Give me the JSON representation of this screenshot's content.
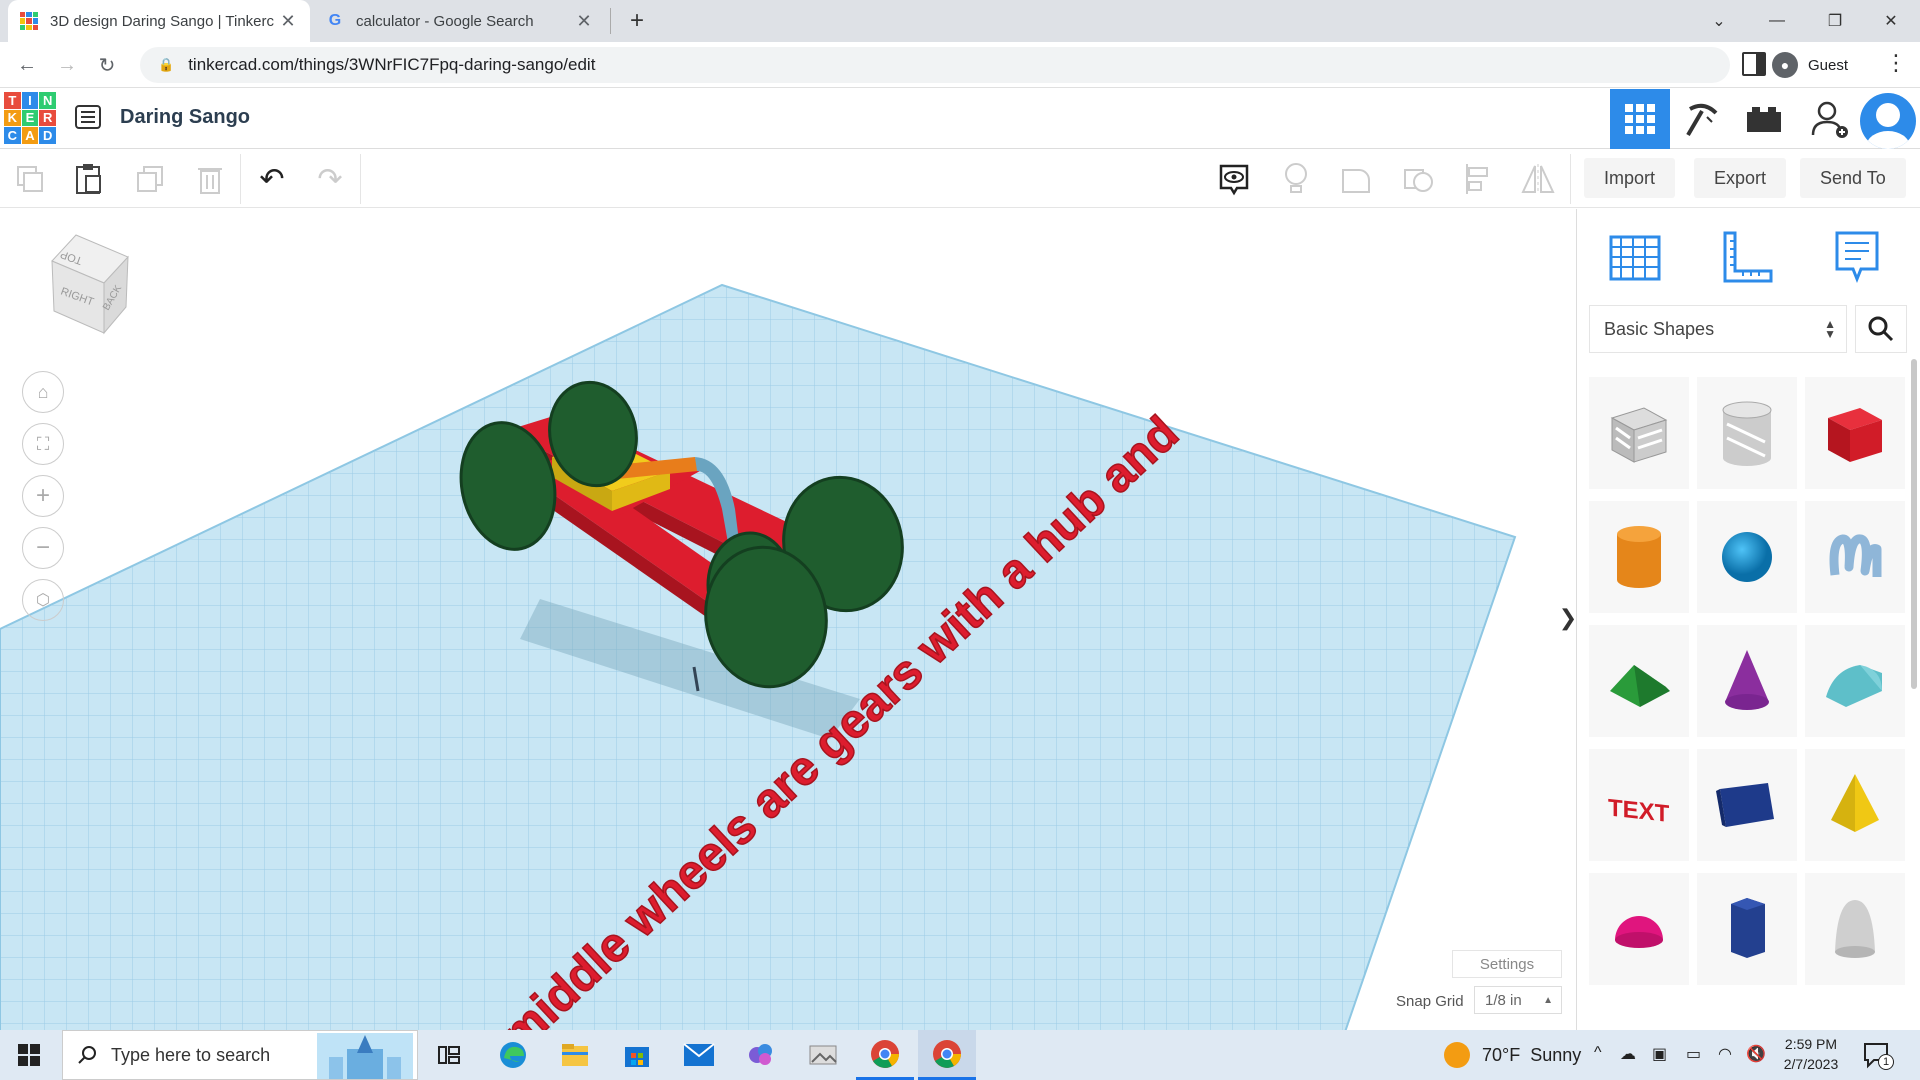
{
  "browser": {
    "tabs": [
      {
        "title": "3D design Daring Sango | Tinkerc",
        "active": true
      },
      {
        "title": "calculator - Google Search",
        "active": false
      }
    ],
    "url": "tinkercad.com/things/3WNrFIC7Fpq-daring-sango/edit",
    "profile_label": "Guest"
  },
  "app": {
    "logo_letters": [
      "T",
      "I",
      "N",
      "K",
      "E",
      "R",
      "C",
      "A",
      "D"
    ],
    "design_name": "Daring Sango",
    "actions": {
      "import": "Import",
      "export": "Export",
      "send_to": "Send To"
    }
  },
  "viewcube": {
    "top": "TOP",
    "right": "RIGHT",
    "back": "BACK"
  },
  "scene": {
    "text_label": "middle wheels are gears with a hub and"
  },
  "panel": {
    "library": "Basic Shapes",
    "shapes": [
      "Box Hole",
      "Cylinder Hole",
      "Box",
      "Cylinder",
      "Sphere",
      "Scribble",
      "Roof",
      "Cone",
      "Round Roof",
      "Text",
      "Shape Generators",
      "Pyramid",
      "Half Sphere",
      "Polygon",
      "Paraboloid"
    ],
    "toggle_glyph": "❯"
  },
  "grid": {
    "settings_label": "Settings",
    "snap_label": "Snap Grid",
    "snap_value": "1/8 in"
  },
  "taskbar": {
    "search_placeholder": "Type here to search",
    "weather_temp": "70°F",
    "weather_desc": "Sunny",
    "time": "2:59 PM",
    "date": "2/7/2023",
    "notification_count": "1"
  },
  "colors": {
    "brand_blue": "#2d8be9",
    "active_grid_btn": "#2d8be9",
    "grid_line": "#8ec7e3",
    "box_red": "#dd1d2e"
  }
}
